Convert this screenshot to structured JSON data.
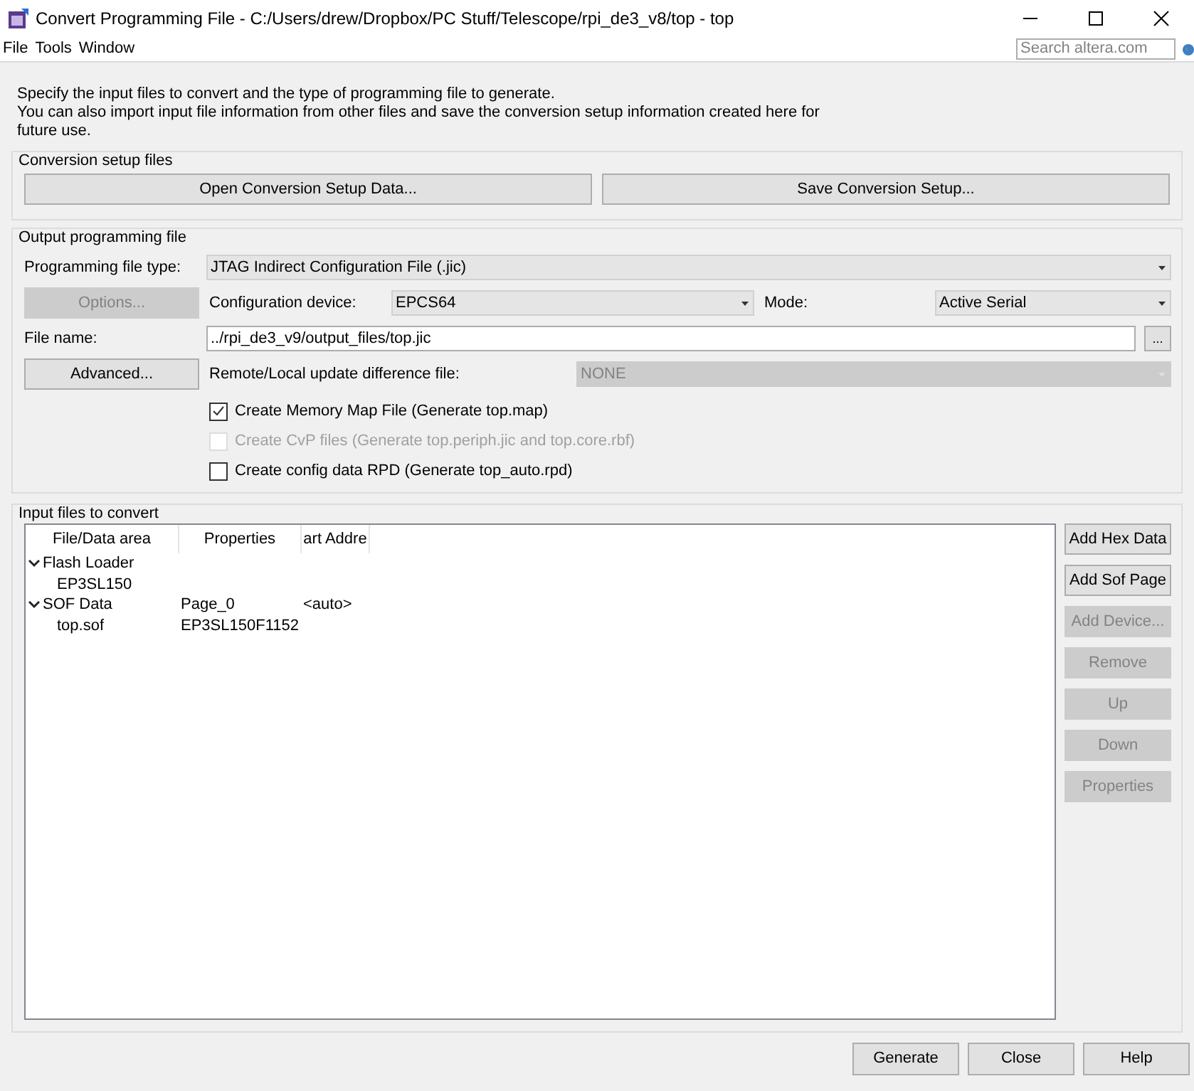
{
  "window": {
    "title": "Convert Programming File - C:/Users/drew/Dropbox/PC Stuff/Telescope/rpi_de3_v8/top - top"
  },
  "menu": [
    "File",
    "Tools",
    "Window"
  ],
  "search": {
    "placeholder": "Search altera.com"
  },
  "intro": "Specify the input files to convert and the type of programming file to generate.\nYou can also import input file information from other files and save the conversion setup information created here for\nfuture use.",
  "setup_group": {
    "title": "Conversion setup files",
    "buttons": [
      {
        "label": "Open Conversion Setup Data...",
        "disabled": false
      },
      {
        "label": "Save Conversion Setup...",
        "disabled": false
      }
    ]
  },
  "output_group": {
    "title": "Output programming file",
    "file_type": {
      "label": "Programming file type:",
      "value": "JTAG Indirect Configuration File (.jic)",
      "disabled": false
    },
    "options_button": {
      "label": "Options...",
      "disabled": true
    },
    "config_device": {
      "label": "Configuration device:",
      "value": "EPCS64",
      "disabled": false
    },
    "mode": {
      "label": "Mode:",
      "value": "Active Serial",
      "disabled": false
    },
    "file_name": {
      "label": "File name:",
      "value": "../rpi_de3_v9/output_files/top.jic",
      "browse": "..."
    },
    "advanced_button": {
      "label": "Advanced...",
      "disabled": false
    },
    "update_file": {
      "label": "Remote/Local update difference file:",
      "value": "NONE",
      "disabled": true
    },
    "checkboxes": [
      {
        "label": "Create Memory Map File (Generate top.map)",
        "checked": true,
        "disabled": false
      },
      {
        "label": "Create CvP files (Generate top.periph.jic and top.core.rbf)",
        "checked": false,
        "disabled": true
      },
      {
        "label": "Create config data RPD (Generate top_auto.rpd)",
        "checked": false,
        "disabled": false
      }
    ]
  },
  "input_group": {
    "title": "Input files to convert",
    "columns": [
      "File/Data area",
      "Properties",
      "art Addre"
    ],
    "tree": [
      {
        "cells": [
          "Flash Loader"
        ],
        "expanded": true,
        "children": [
          {
            "cells": [
              "EP3SL150"
            ]
          }
        ]
      },
      {
        "cells": [
          "SOF Data",
          "Page_0",
          "<auto>"
        ],
        "expanded": true,
        "children": [
          {
            "cells": [
              "top.sof",
              "EP3SL150F1152"
            ]
          }
        ]
      }
    ],
    "buttons": [
      {
        "label": "Add Hex Data",
        "disabled": false
      },
      {
        "label": "Add Sof Page",
        "disabled": false
      },
      {
        "label": "Add Device...",
        "disabled": true
      },
      {
        "label": "Remove",
        "disabled": true
      },
      {
        "label": "Up",
        "disabled": true
      },
      {
        "label": "Down",
        "disabled": true
      },
      {
        "label": "Properties",
        "disabled": true
      }
    ]
  },
  "footer_buttons": [
    {
      "label": "Generate",
      "disabled": false
    },
    {
      "label": "Close",
      "disabled": false
    },
    {
      "label": "Help",
      "disabled": false
    }
  ]
}
